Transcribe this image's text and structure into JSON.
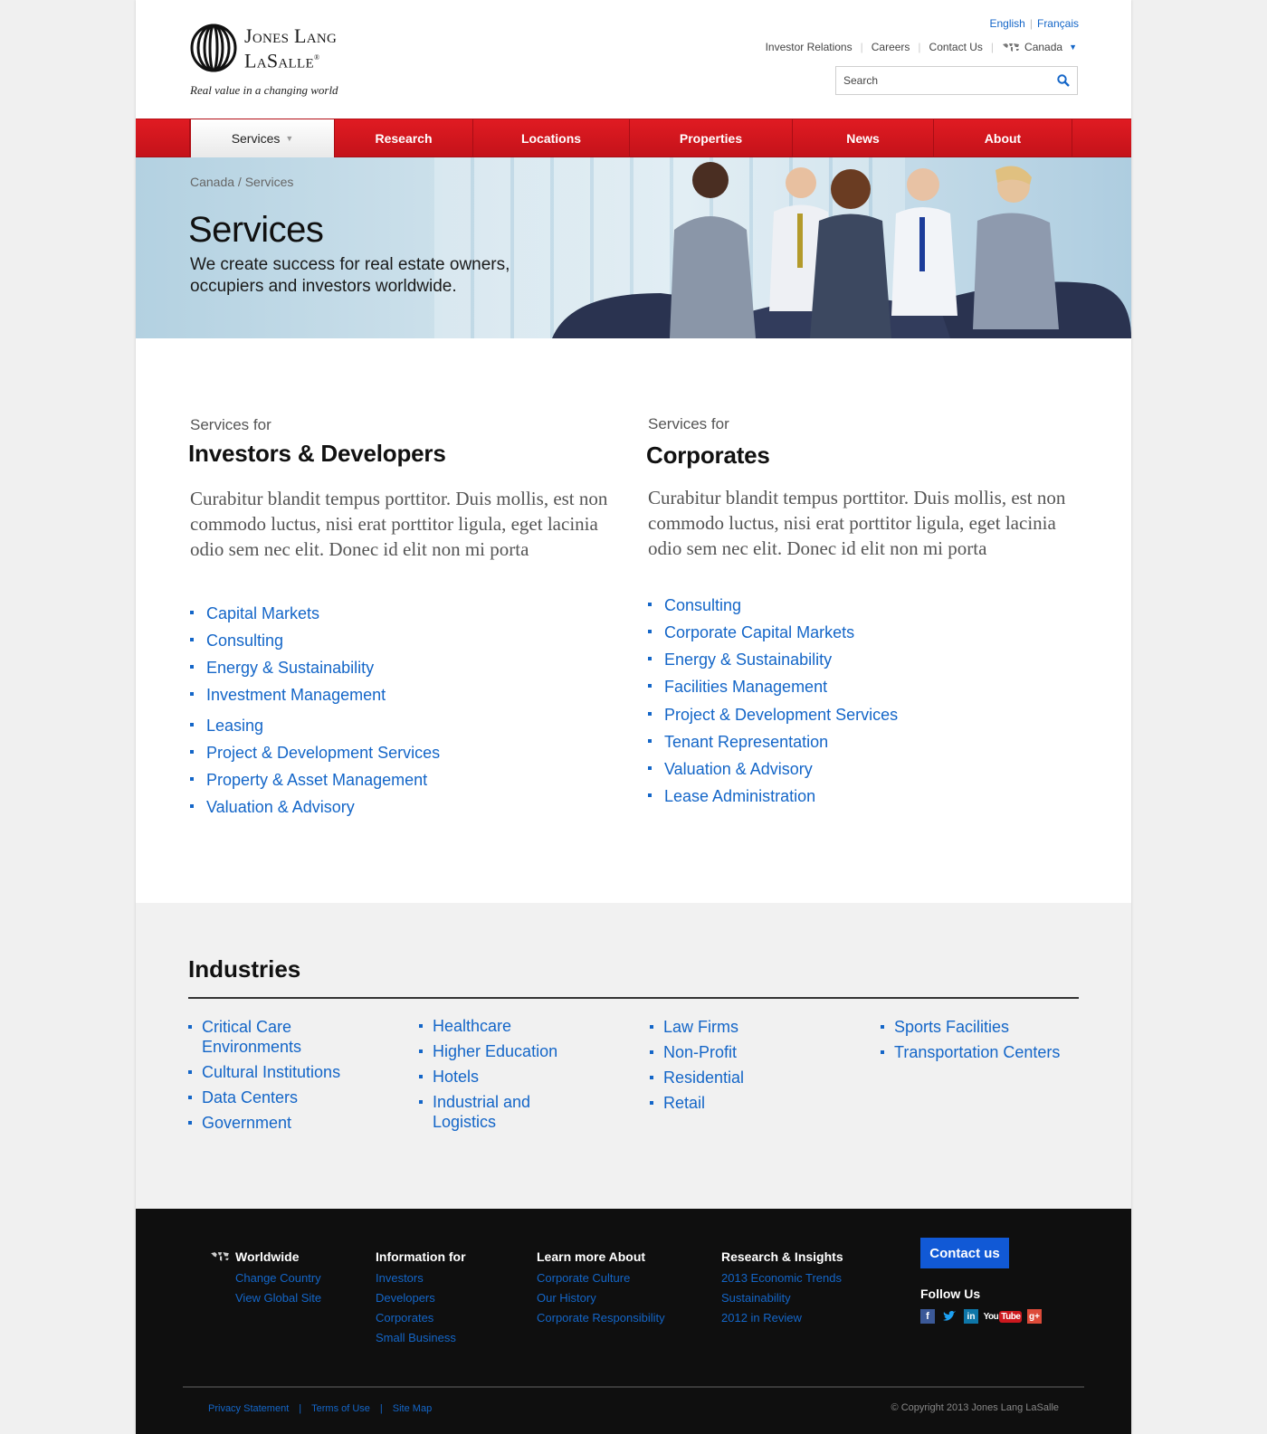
{
  "brand": {
    "name_line1": "Jones Lang",
    "name_line2": "LaSalle",
    "tagline": "Real value in a changing world"
  },
  "language": {
    "options": [
      "English",
      "Français"
    ]
  },
  "utility_nav": {
    "items": [
      "Investor Relations",
      "Careers",
      "Contact Us"
    ],
    "country": "Canada"
  },
  "search": {
    "placeholder": "Search"
  },
  "main_nav": {
    "items": [
      {
        "label": "Services",
        "active": true
      },
      {
        "label": "Research"
      },
      {
        "label": "Locations"
      },
      {
        "label": "Properties"
      },
      {
        "label": "News"
      },
      {
        "label": "About"
      }
    ]
  },
  "hero": {
    "breadcrumb": "Canada / Services",
    "title": "Services",
    "subtitle": "We create success for real estate owners, occupiers and investors worldwide."
  },
  "services": [
    {
      "prefix": "Services for",
      "title": "Investors & Developers",
      "description": "Curabitur blandit tempus porttitor. Duis mollis, est non commodo luctus, nisi erat porttitor ligula, eget lacinia odio sem nec elit. Donec id elit non mi porta",
      "items": [
        "Capital Markets",
        "Consulting",
        "Energy & Sustainability",
        "Investment Management",
        "Leasing",
        "Project & Development Services",
        "Property & Asset Management",
        "Valuation & Advisory"
      ]
    },
    {
      "prefix": "Services for",
      "title": "Corporates",
      "description": "Curabitur blandit tempus porttitor. Duis mollis, est non commodo luctus, nisi erat porttitor ligula, eget lacinia odio sem nec elit. Donec id elit non mi porta",
      "items": [
        "Consulting",
        "Corporate Capital Markets",
        "Energy & Sustainability",
        "Facilities Management",
        "Project & Development Services",
        "Tenant Representation",
        "Valuation & Advisory",
        "Lease Administration"
      ]
    }
  ],
  "industries": {
    "title": "Industries",
    "columns": [
      [
        "Critical Care Environments",
        "Cultural Institutions",
        "Data Centers",
        "Government"
      ],
      [
        "Healthcare",
        "Higher Education",
        "Hotels",
        "Industrial and Logistics"
      ],
      [
        "Law Firms",
        "Non-Profit",
        "Residential",
        "Retail"
      ],
      [
        "Sports Facilities",
        "Transportation Centers"
      ]
    ]
  },
  "footer": {
    "columns": [
      {
        "heading": "Worldwide",
        "links": [
          "Change Country",
          "View Global Site"
        ]
      },
      {
        "heading": "Information for",
        "links": [
          "Investors",
          "Developers",
          "Corporates",
          "Small Business"
        ]
      },
      {
        "heading": "Learn more About",
        "links": [
          "Corporate Culture",
          "Our History",
          "Corporate Responsibility"
        ]
      },
      {
        "heading": "Research & Insights",
        "links": [
          "2013 Economic Trends",
          "Sustainability",
          "2012 in Review"
        ]
      }
    ],
    "contact_label": "Contact us",
    "follow_label": "Follow Us",
    "social": [
      "facebook-icon",
      "twitter-icon",
      "linkedin-icon",
      "youtube-icon",
      "googleplus-icon"
    ],
    "bottom_links": [
      "Privacy Statement",
      "Terms of Use",
      "Site Map"
    ],
    "copyright": "© Copyright 2013 Jones Lang LaSalle"
  },
  "colors": {
    "brand_red": "#d7161e",
    "link_blue": "#1466c8",
    "button_blue": "#1159d6",
    "footer_bg": "#0f0f0f"
  }
}
